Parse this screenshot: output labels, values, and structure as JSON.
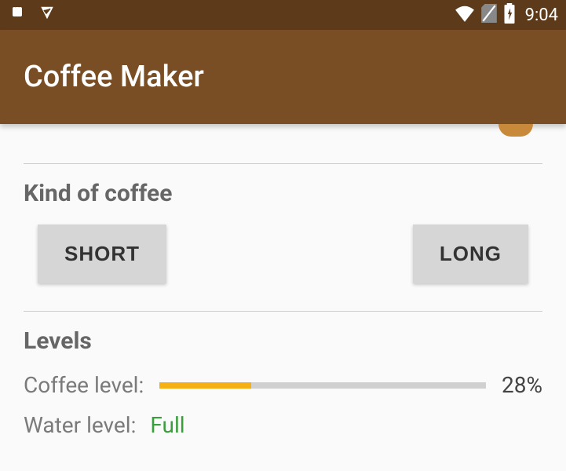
{
  "status": {
    "time": "9:04"
  },
  "app": {
    "title": "Coffee Maker"
  },
  "coffee": {
    "section_title": "Kind of coffee",
    "short_label": "SHORT",
    "long_label": "LONG"
  },
  "levels": {
    "section_title": "Levels",
    "coffee_label": "Coffee level:",
    "coffee_percent": 28,
    "coffee_value": "28%",
    "water_label": "Water level:",
    "water_status": "Full"
  }
}
